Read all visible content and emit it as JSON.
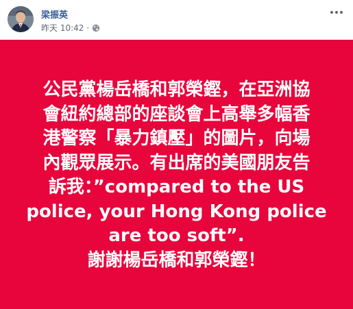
{
  "post": {
    "author": "梁振英",
    "time": "昨天 10:42",
    "separator": "·",
    "privacy_icon": "globe-icon",
    "more_icon": "more-options-icon"
  },
  "image": {
    "background_color": "#e8053c",
    "text_color": "#ffffff",
    "lines": [
      "公民黨楊岳橋和郭榮鏗，在亞洲協",
      "會紐約總部的座談會上高舉多幅香",
      "港警察「暴力鎮壓」的圖片，向場",
      "內觀眾展示。有出席的美國朋友告",
      "訴我：”compared to the US",
      "police, your Hong Kong police",
      "are too soft”.",
      "謝謝楊岳橋和郭榮鏗！"
    ]
  }
}
